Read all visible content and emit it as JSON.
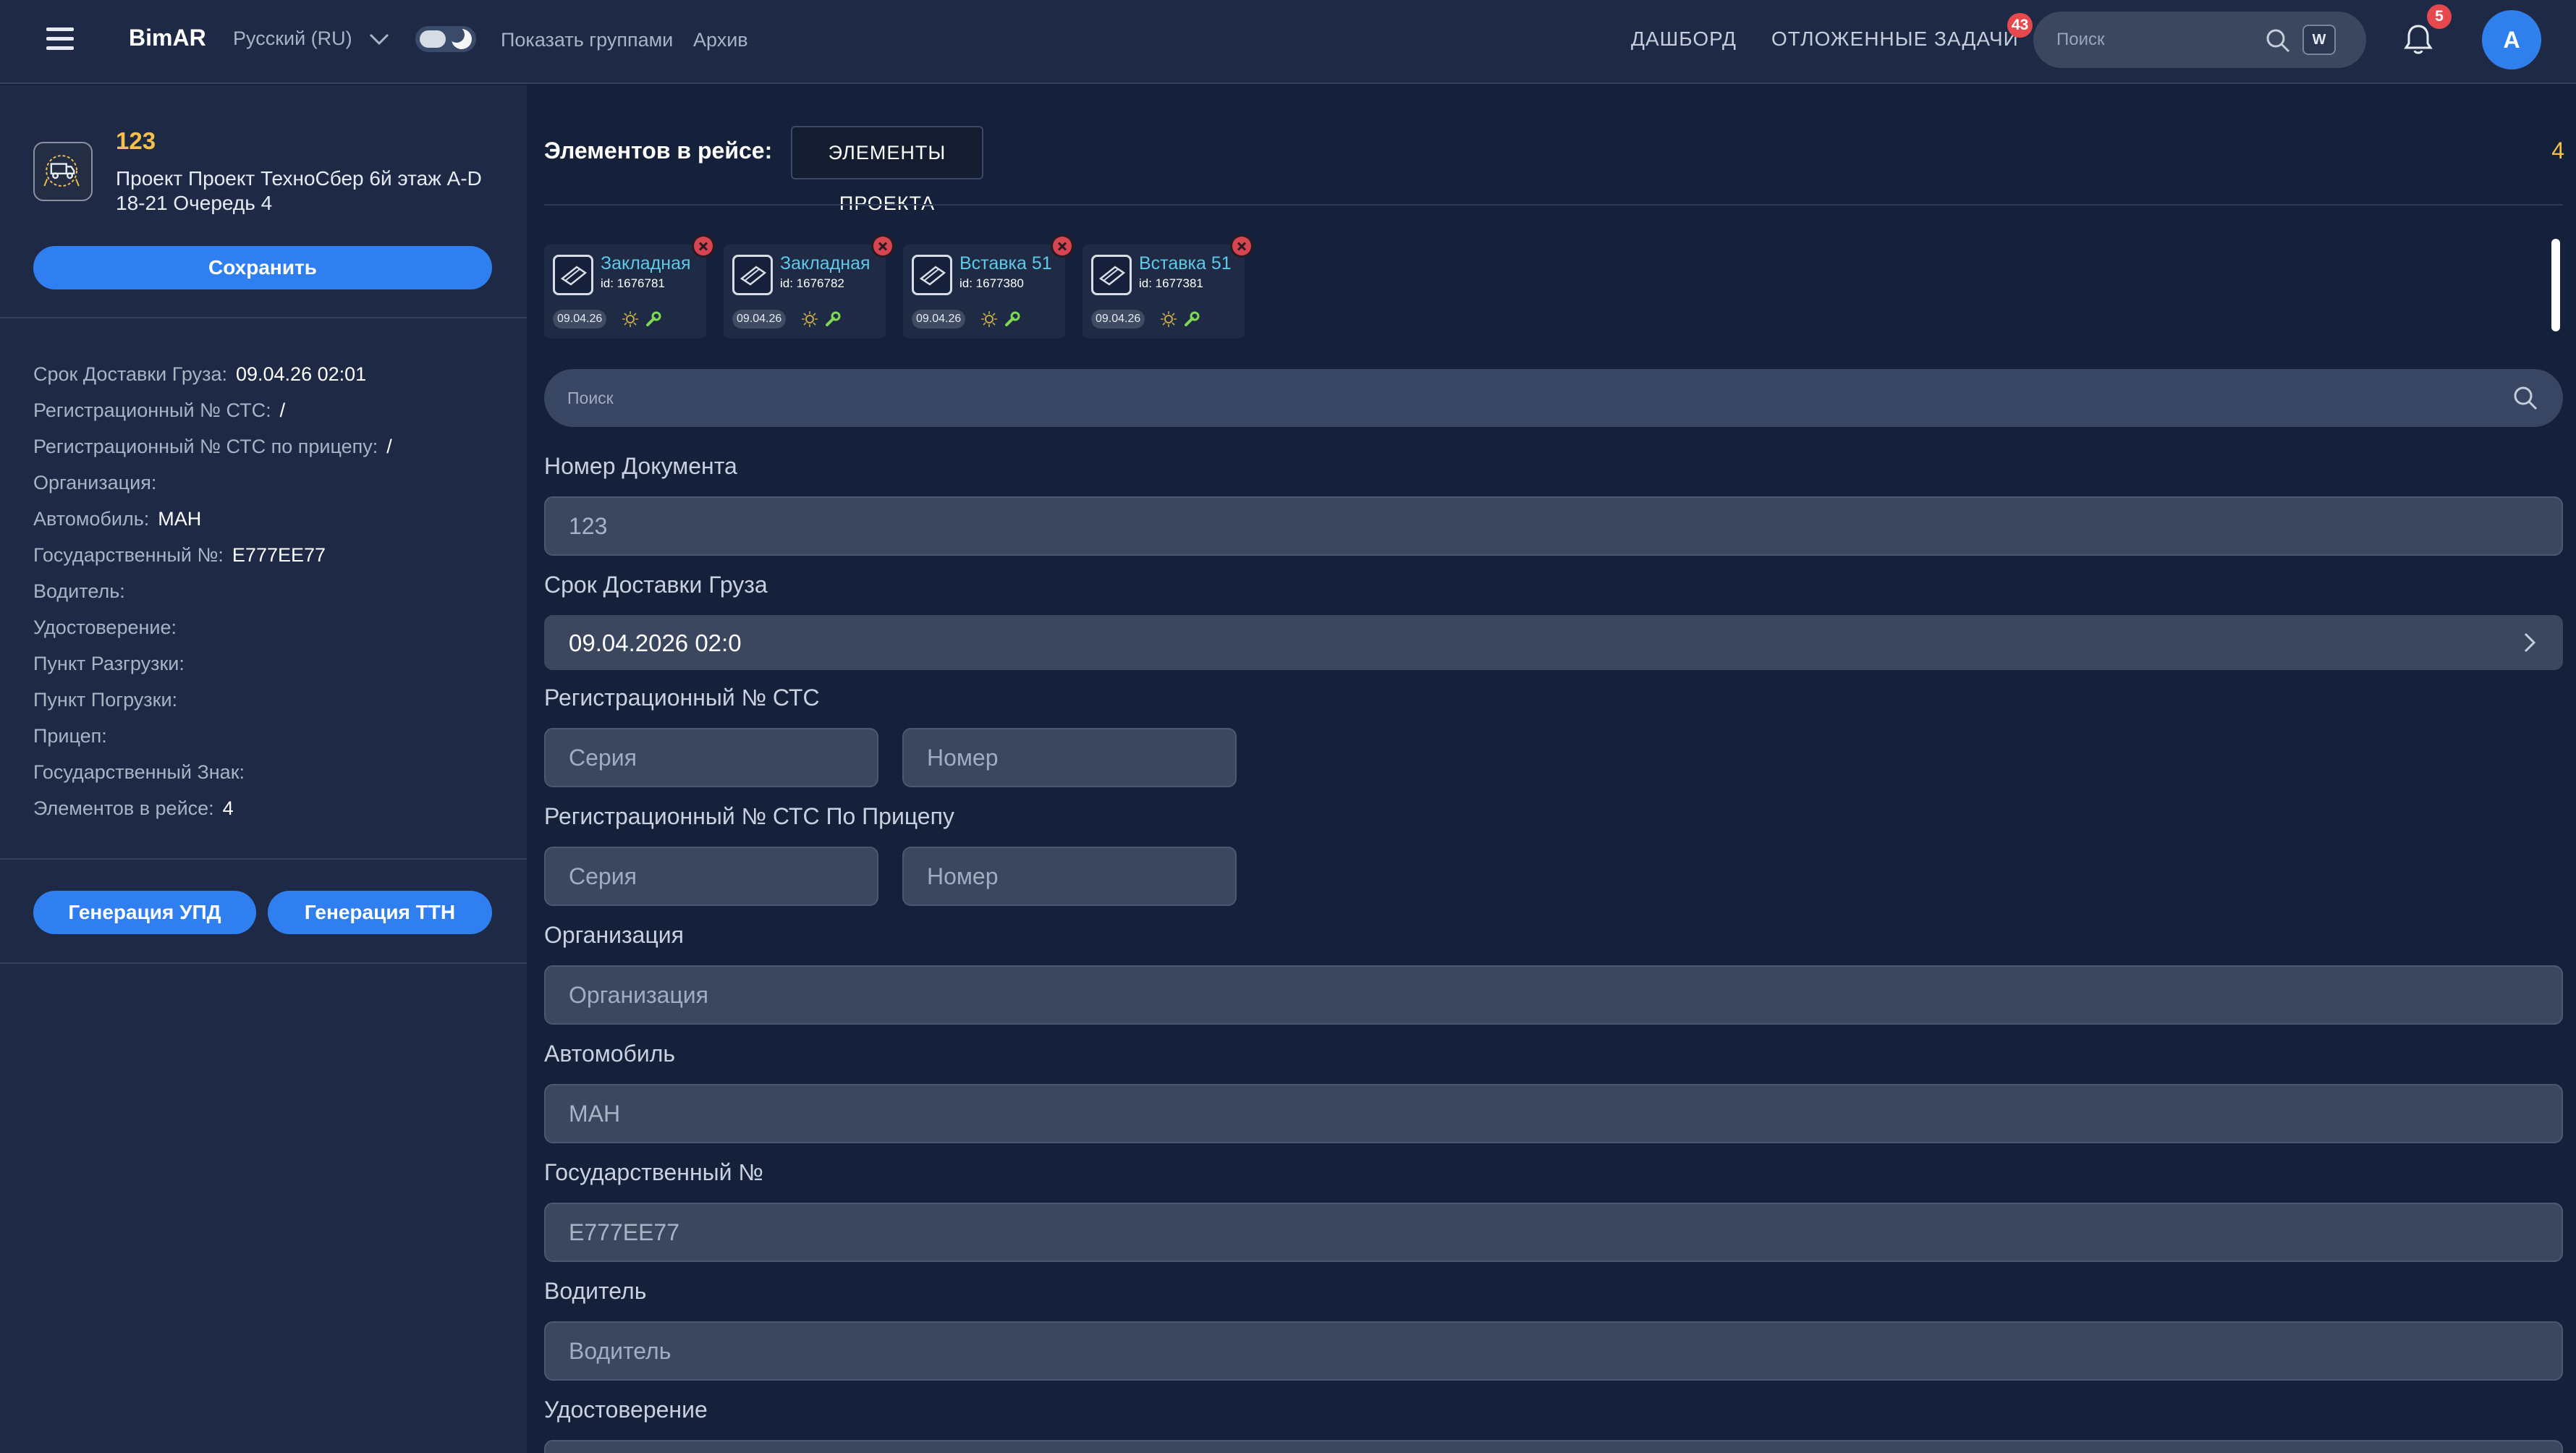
{
  "header": {
    "brand": "BimAR",
    "language": "Русский (RU)",
    "show_groups": "Показать группами",
    "archive": "Архив",
    "nav_dashboard": "ДАШБОРД",
    "nav_deferred": "ОТЛОЖЕННЫЕ ЗАДАЧИ",
    "deferred_badge": "43",
    "search_placeholder": "Поиск",
    "search_shortcut": "W",
    "notifications_badge": "5",
    "avatar_initial": "А"
  },
  "sidebar": {
    "project_number": "123",
    "project_name": "Проект Проект ТехноСбер 6й этаж A-D 18-21 Очередь 4",
    "save_label": "Сохранить",
    "info": [
      {
        "label": "Срок Доставки Груза:",
        "value": "09.04.26 02:01"
      },
      {
        "label": "Регистрационный № СТС:",
        "value": "/"
      },
      {
        "label": "Регистрационный № СТС по прицепу:",
        "value": "/"
      },
      {
        "label": "Организация:",
        "value": ""
      },
      {
        "label": "Автомобиль:",
        "value": "МАН"
      },
      {
        "label": "Государственный №:",
        "value": "Е777ЕЕ77"
      },
      {
        "label": "Водитель:",
        "value": ""
      },
      {
        "label": "Удостоверение:",
        "value": ""
      },
      {
        "label": "Пункт Разгрузки:",
        "value": ""
      },
      {
        "label": "Пункт Погрузки:",
        "value": ""
      },
      {
        "label": "Прицеп:",
        "value": ""
      },
      {
        "label": "Государственный Знак:",
        "value": ""
      },
      {
        "label": "Элементов в рейсе:",
        "value": "4"
      }
    ],
    "gen_upd_label": "Генерация УПД",
    "gen_ttn_label": "Генерация ТТН"
  },
  "main": {
    "title": "Элементов в рейсе:",
    "project_elements_label": "ЭЛЕМЕНТЫ ПРОЕКТА",
    "count": "4",
    "cards": [
      {
        "title": "Закладная",
        "id": "id: 1676781",
        "date": "09.04.26"
      },
      {
        "title": "Закладная",
        "id": "id: 1676782",
        "date": "09.04.26"
      },
      {
        "title": "Вставка 51",
        "id": "id: 1677380",
        "date": "09.04.26"
      },
      {
        "title": "Вставка 51",
        "id": "id: 1677381",
        "date": "09.04.26"
      }
    ],
    "search_placeholder": "Поиск",
    "form": {
      "doc_number_label": "Номер Документа",
      "doc_number_value": "123",
      "delivery_label": "Срок Доставки Груза",
      "delivery_value": "09.04.2026 02:0",
      "sts_label": "Регистрационный № СТС",
      "sts_series_placeholder": "Серия",
      "sts_number_placeholder": "Номер",
      "sts_trailer_label": "Регистрационный № СТС По Прицепу",
      "sts_trailer_series_placeholder": "Серия",
      "sts_trailer_number_placeholder": "Номер",
      "org_label": "Организация",
      "org_placeholder": "Организация",
      "car_label": "Автомобиль",
      "car_value": "МАН",
      "plate_label": "Государственный №",
      "plate_value": "Е777ЕЕ77",
      "driver_label": "Водитель",
      "driver_placeholder": "Водитель",
      "license_label": "Удостоверение"
    }
  },
  "colors": {
    "accent": "#2f7ff0",
    "highlight": "#f5c14b",
    "card_title": "#5ec8e8",
    "badge": "#e5484d"
  }
}
